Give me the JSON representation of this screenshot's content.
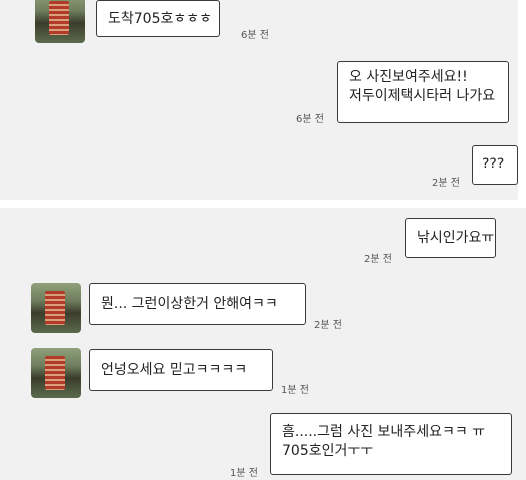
{
  "messages": [
    {
      "side": "received",
      "lines": [
        "도착705호ㅎㅎㅎ"
      ],
      "time": "6분 전"
    },
    {
      "side": "sent",
      "lines": [
        "오 사진보여주세요!!",
        "저두이제택시타러 나가요"
      ],
      "time": "6분 전"
    },
    {
      "side": "sent",
      "lines": [
        "???"
      ],
      "time": "2분 전"
    },
    {
      "side": "sent",
      "lines": [
        "낚시인가요ㅠ"
      ],
      "time": "2분 전"
    },
    {
      "side": "received",
      "lines": [
        "뭔... 그런이상한거 안해여ㅋㅋ"
      ],
      "time": "2분 전"
    },
    {
      "side": "received",
      "lines": [
        "언넝오세요 믿고ㅋㅋㅋㅋ"
      ],
      "time": "1분 전"
    },
    {
      "side": "sent",
      "lines": [
        "흠.....그럼 사진 보내주세요ㅋㅋ ㅠ",
        "705호인거ㅜㅜ"
      ],
      "time": "1분 전"
    }
  ]
}
